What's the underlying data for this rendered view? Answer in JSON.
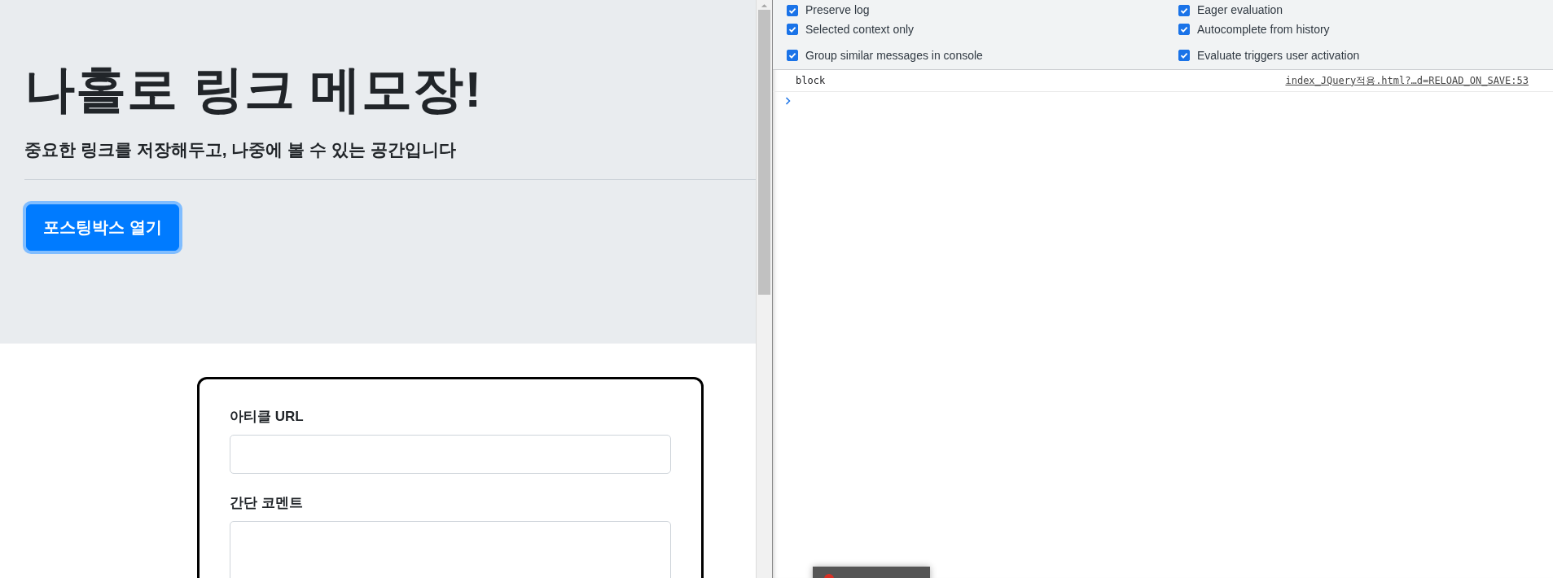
{
  "page": {
    "title": "나홀로 링크 메모장!",
    "subtitle": "중요한 링크를 저장해두고, 나중에 볼 수 있는 공간입니다",
    "open_button": "포스팅박스 열기",
    "form": {
      "fields": [
        {
          "label": "아티클 URL",
          "kind": "input"
        },
        {
          "label": "간단 코멘트",
          "kind": "textarea"
        }
      ]
    }
  },
  "devtools": {
    "settings": [
      {
        "label": "Preserve log",
        "checked": true
      },
      {
        "label": "Eager evaluation",
        "checked": true
      },
      {
        "label": "Selected context only",
        "checked": true
      },
      {
        "label": "Autocomplete from history",
        "checked": true
      },
      {
        "label": "Group similar messages in console",
        "checked": true
      },
      {
        "label": "Evaluate triggers user activation",
        "checked": true
      }
    ],
    "console": {
      "messages": [
        {
          "text": "block",
          "source": "index_JQuery적용.html?…d=RELOAD_ON_SAVE:53"
        }
      ]
    }
  }
}
